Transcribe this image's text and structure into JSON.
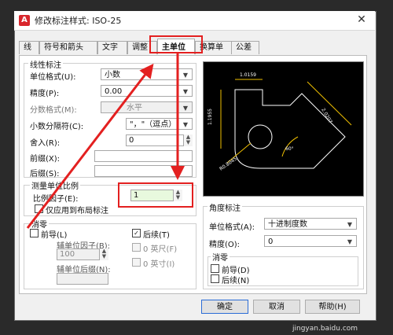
{
  "window": {
    "title": "修改标注样式: ISO-25",
    "icon_letter": "A",
    "close_glyph": "✕"
  },
  "tabs": [
    {
      "label": "线"
    },
    {
      "label": "符号和箭头"
    },
    {
      "label": "文字"
    },
    {
      "label": "调整"
    },
    {
      "label": "主单位",
      "active": true
    },
    {
      "label": "换算单位"
    },
    {
      "label": "公差"
    }
  ],
  "linear": {
    "title": "线性标注",
    "unit_format": {
      "label": "单位格式(U):",
      "value": "小数"
    },
    "precision": {
      "label": "精度(P):",
      "value": "0.00"
    },
    "fraction_format": {
      "label": "分数格式(M):",
      "value": "水平"
    },
    "decimal_sep": {
      "label": "小数分隔符(C):",
      "value": "\"，\"（逗点）"
    },
    "round_off": {
      "label": "舍入(R):",
      "value": "0"
    },
    "prefix": {
      "label": "前缀(X):",
      "value": ""
    },
    "suffix": {
      "label": "后缀(S):",
      "value": ""
    }
  },
  "scale": {
    "title": "测量单位比例",
    "factor": {
      "label": "比例因子(E):",
      "value": "1"
    },
    "layout_only": {
      "label": "仅应用到布局标注"
    }
  },
  "zero_suppress": {
    "title": "消零",
    "leading": {
      "label": "前导(L)"
    },
    "trailing": {
      "label": "后续(T)",
      "checked": true
    },
    "sub_factor": {
      "label": "辅单位因子(B):",
      "value": "100"
    },
    "sub_suffix": {
      "label": "辅单位后缀(N):",
      "value": ""
    },
    "feet": {
      "label": "0 英尺(F)"
    },
    "inches": {
      "label": "0 英寸(I)"
    }
  },
  "angular": {
    "title": "角度标注",
    "unit_format": {
      "label": "单位格式(A):",
      "value": "十进制度数"
    },
    "precision": {
      "label": "精度(O):",
      "value": "0"
    },
    "zero_title": "消零",
    "leading": {
      "label": "前导(D)"
    },
    "trailing": {
      "label": "后续(N)"
    }
  },
  "preview_labels": {
    "d1": "1.0159",
    "d2": "1.1955",
    "d3": "2.0207",
    "d4": "R0.8045",
    "ang": "60°"
  },
  "buttons": {
    "ok": "确定",
    "cancel": "取消",
    "help": "帮助(H)"
  },
  "watermark": "jingyan.baidu.com",
  "colors": {
    "annotation_red": "#e32020",
    "preview_bg": "#000000",
    "drawing_line": "#ffffff",
    "dim_line": "#f0c000"
  }
}
